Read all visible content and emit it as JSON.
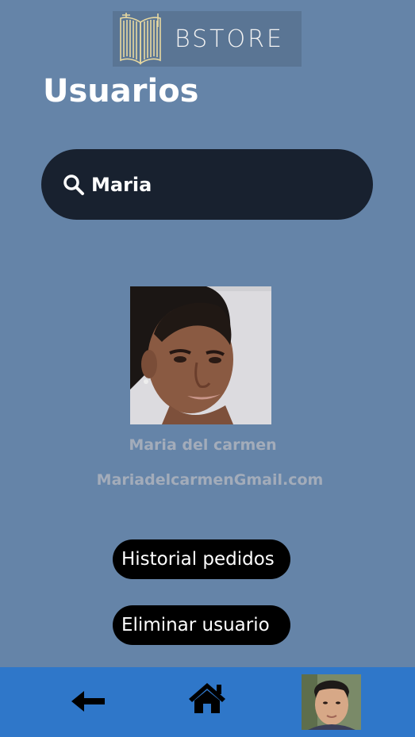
{
  "brand": {
    "logo_text": "BSTORE",
    "logo_icon": "open-book-icon"
  },
  "page": {
    "title": "Usuarios"
  },
  "search": {
    "icon": "search-icon",
    "value": "Maria"
  },
  "user": {
    "photo_icon": "user-photo",
    "name": "Maria del carmen",
    "email": "MariadelcarmenGmail.com"
  },
  "actions": {
    "history_label": "Historial pedidos",
    "delete_label": "Eliminar usuario"
  },
  "nav": {
    "back_icon": "arrow-left-icon",
    "home_icon": "home-icon",
    "profile_icon": "profile-avatar"
  },
  "colors": {
    "background": "#6584a8",
    "search_bg": "#18212f",
    "button_bg": "#000000",
    "nav_bg": "#2f77c9",
    "muted_text": "#a3acba"
  }
}
